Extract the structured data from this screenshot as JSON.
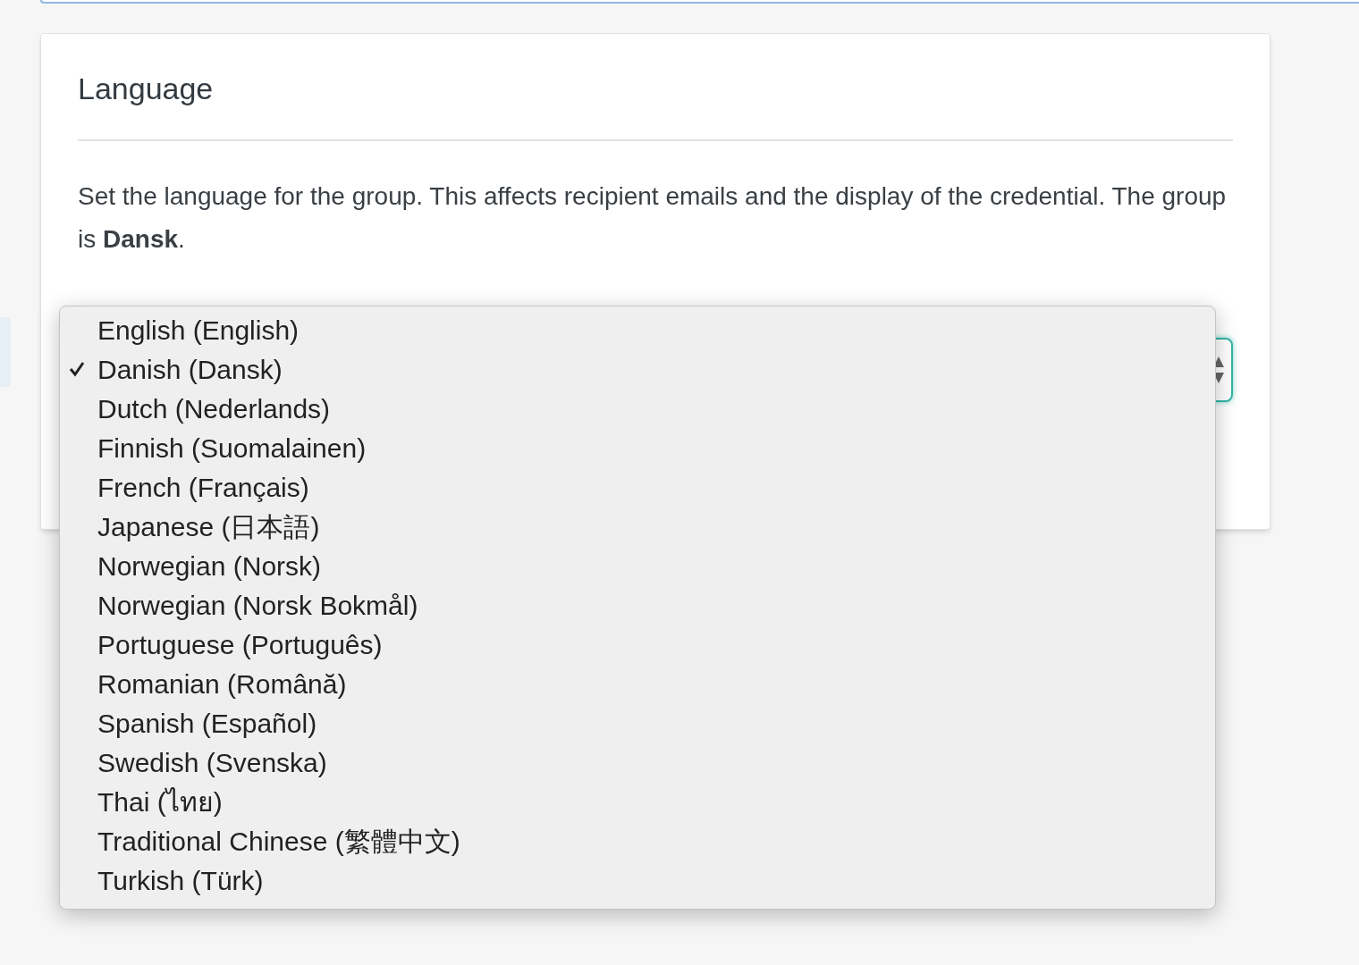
{
  "card": {
    "title": "Language",
    "description": "Set the language for the group. This affects recipient emails and the display of the credential. The group is **Dansk**."
  },
  "language_menu": [
    {
      "label": "English (English)",
      "selected": false
    },
    {
      "label": "Danish (Dansk)",
      "selected": true
    },
    {
      "label": "Dutch (Nederlands)",
      "selected": false
    },
    {
      "label": "Finnish (Suomalainen)",
      "selected": false
    },
    {
      "label": "French (Français)",
      "selected": false
    },
    {
      "label": "Japanese (日本語)",
      "selected": false
    },
    {
      "label": "Norwegian (Norsk)",
      "selected": false
    },
    {
      "label": "Norwegian (Norsk Bokmål)",
      "selected": false
    },
    {
      "label": "Portuguese (Português)",
      "selected": false
    },
    {
      "label": "Romanian (Română)",
      "selected": false
    },
    {
      "label": "Spanish (Español)",
      "selected": false
    },
    {
      "label": "Swedish (Svenska)",
      "selected": false
    },
    {
      "label": "Thai (ไทย)",
      "selected": false
    },
    {
      "label": "Traditional Chinese (繁體中文)",
      "selected": false
    },
    {
      "label": "Turkish (Türk)",
      "selected": false
    }
  ]
}
